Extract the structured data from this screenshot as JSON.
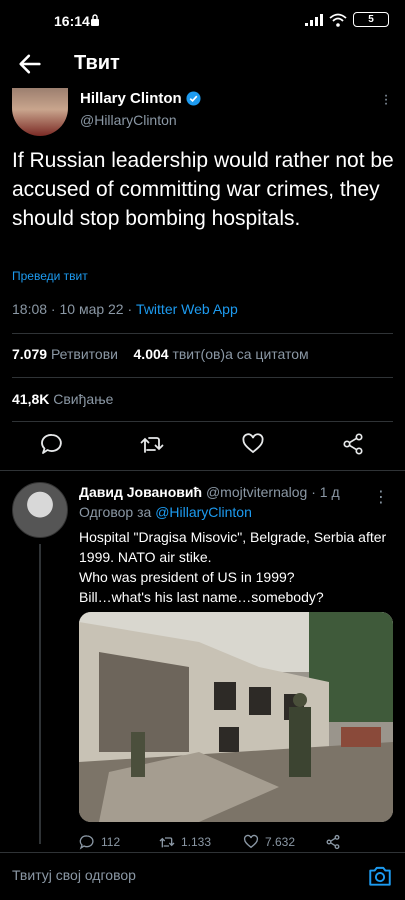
{
  "status_bar": {
    "time": "16:14",
    "battery": "5"
  },
  "header": {
    "title": "Твит"
  },
  "tweet": {
    "author_name": "Hillary Clinton",
    "author_handle": "@HillaryClinton",
    "text": "If Russian leadership would rather not be accused of committing war crimes, they should stop bombing hospitals.",
    "translate_label": "Преведи твит",
    "time": "18:08 · 10 мар 22 · ",
    "source": "Twitter Web App",
    "retweets_count": "7.079",
    "retweets_label": "Ретвитови",
    "quotes_count": "4.004",
    "quotes_label": "твит(ов)а са цитатом",
    "likes_count": "41,8K",
    "likes_label": "Свиђање"
  },
  "reply": {
    "name": "Давид Јовановић",
    "handle": "@mojtviternalog",
    "age": "· 1 д",
    "replying_prefix": "Одговор за",
    "replying_handle": "@HillaryClinton",
    "lines": [
      "Hospital \"Dragisa Misovic\", Belgrade, Serbia after 1999. NATO air stike.",
      "Who was president of US in 1999?",
      "Bill…what's his last name…somebody?"
    ],
    "reply_count": "112",
    "retweet_count": "1.133",
    "like_count": "7.632"
  },
  "compose": {
    "placeholder": "Твитуј свој одговор"
  },
  "colors": {
    "background": "#000000",
    "accent": "#1d9bf0",
    "muted": "#8b98a5",
    "divider": "#2f3336"
  }
}
